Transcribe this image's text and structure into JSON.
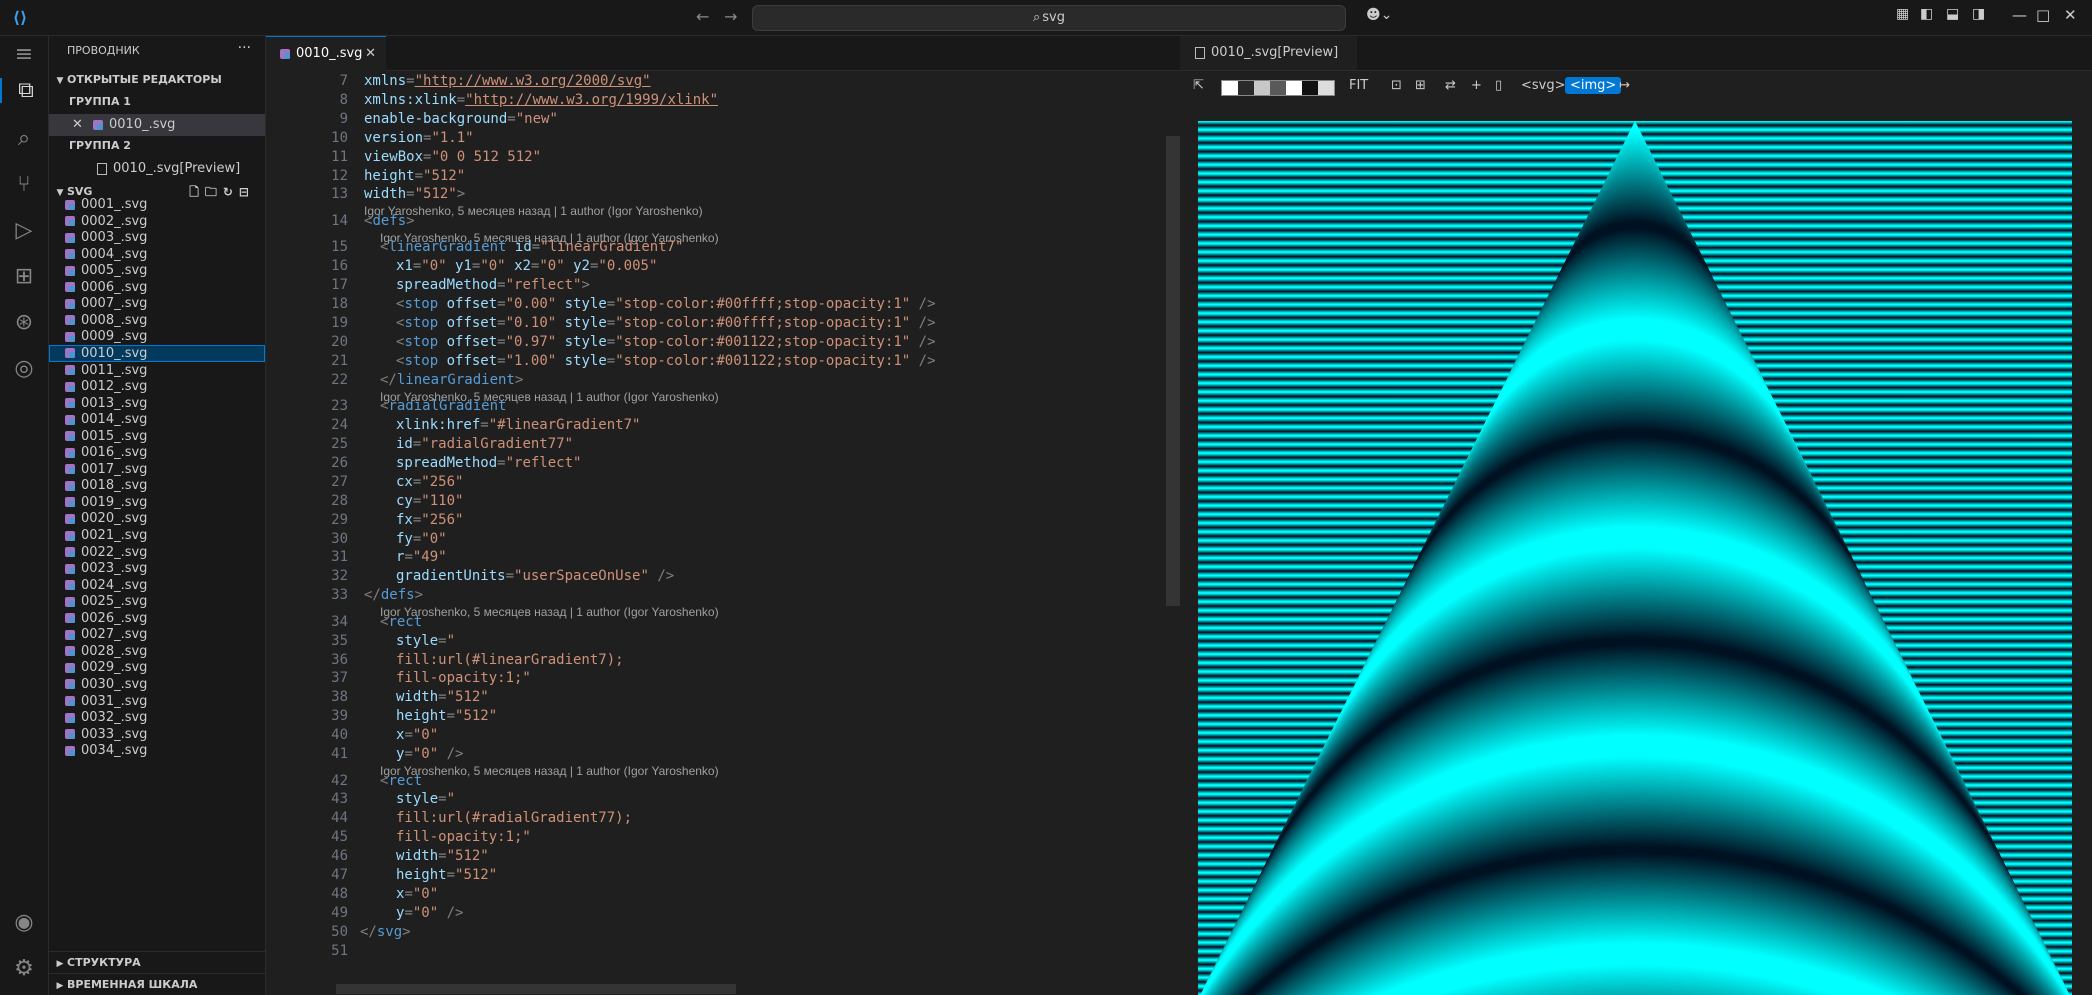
{
  "titlebar": {
    "search_text": "svg",
    "logo": "vscode-logo",
    "back": "←",
    "forward": "→"
  },
  "activity_bar": {
    "icons": [
      "menu-icon",
      "explorer-icon",
      "search-icon",
      "source-control-icon",
      "run-debug-icon",
      "extensions-icon",
      "git-graph-icon",
      "remote-explorer-icon",
      "account-icon",
      "settings-icon"
    ]
  },
  "sidebar": {
    "title": "ПРОВОДНИК",
    "open_editors_label": "ОТКРЫТЫЕ РЕДАКТОРЫ",
    "group1_label": "ГРУППА 1",
    "group1_file": "0010_.svg",
    "group2_label": "ГРУППА 2",
    "group2_file": "0010_.svg[Preview]",
    "folder_label": "SVG",
    "files": [
      "0001_.svg",
      "0002_.svg",
      "0003_.svg",
      "0004_.svg",
      "0005_.svg",
      "0006_.svg",
      "0007_.svg",
      "0008_.svg",
      "0009_.svg",
      "0010_.svg",
      "0011_.svg",
      "0012_.svg",
      "0013_.svg",
      "0014_.svg",
      "0015_.svg",
      "0016_.svg",
      "0017_.svg",
      "0018_.svg",
      "0019_.svg",
      "0020_.svg",
      "0021_.svg",
      "0022_.svg",
      "0023_.svg",
      "0024_.svg",
      "0025_.svg",
      "0026_.svg",
      "0027_.svg",
      "0028_.svg",
      "0029_.svg",
      "0030_.svg",
      "0031_.svg",
      "0032_.svg",
      "0033_.svg",
      "0034_.svg"
    ],
    "selected_file": "0010_.svg",
    "outline_label": "СТРУКТУРА",
    "timeline_label": "ВРЕМЕННАЯ ШКАЛА"
  },
  "editor": {
    "tab_label": "0010_.svg",
    "blame_text": "Igor Yaroshenko, 5 месяцев назад | 1 author (Igor Yaroshenko)",
    "lines": [
      {
        "n": "7",
        "indent": 1,
        "parts": [
          [
            "attr",
            "xmlns"
          ],
          [
            "punc",
            "="
          ],
          [
            "ustr",
            "\"http://www.w3.org/2000/svg\""
          ]
        ]
      },
      {
        "n": "8",
        "indent": 1,
        "parts": [
          [
            "attr",
            "xmlns:xlink"
          ],
          [
            "punc",
            "="
          ],
          [
            "ustr",
            "\"http://www.w3.org/1999/xlink\""
          ]
        ]
      },
      {
        "n": "9",
        "indent": 1,
        "parts": [
          [
            "attr",
            "enable-background"
          ],
          [
            "punc",
            "="
          ],
          [
            "str",
            "\"new\""
          ]
        ]
      },
      {
        "n": "10",
        "indent": 1,
        "parts": [
          [
            "attr",
            "version"
          ],
          [
            "punc",
            "="
          ],
          [
            "str",
            "\"1.1\""
          ]
        ]
      },
      {
        "n": "11",
        "indent": 1,
        "parts": [
          [
            "attr",
            "viewBox"
          ],
          [
            "punc",
            "="
          ],
          [
            "str",
            "\"0 0 512 512\""
          ]
        ]
      },
      {
        "n": "12",
        "indent": 1,
        "parts": [
          [
            "attr",
            "height"
          ],
          [
            "punc",
            "="
          ],
          [
            "str",
            "\"512\""
          ]
        ]
      },
      {
        "n": "13",
        "indent": 1,
        "parts": [
          [
            "attr",
            "width"
          ],
          [
            "punc",
            "="
          ],
          [
            "str",
            "\"512\""
          ],
          [
            "punc",
            ">"
          ]
        ],
        "blame_after": "0"
      },
      {
        "n": "14",
        "indent": 1,
        "parts": [
          [
            "punc",
            "<"
          ],
          [
            "tag",
            "defs"
          ],
          [
            "punc",
            ">"
          ]
        ],
        "blame_after": "1"
      },
      {
        "n": "15",
        "indent": 2,
        "parts": [
          [
            "punc",
            "<"
          ],
          [
            "tag",
            "linearGradient"
          ],
          [
            "text",
            " "
          ],
          [
            "attr",
            "id"
          ],
          [
            "punc",
            "="
          ],
          [
            "str",
            "\"linearGradient7\""
          ]
        ]
      },
      {
        "n": "16",
        "indent": 3,
        "parts": [
          [
            "attr",
            "x1"
          ],
          [
            "punc",
            "="
          ],
          [
            "str",
            "\"0\""
          ],
          [
            "text",
            " "
          ],
          [
            "attr",
            "y1"
          ],
          [
            "punc",
            "="
          ],
          [
            "str",
            "\"0\""
          ],
          [
            "text",
            " "
          ],
          [
            "attr",
            "x2"
          ],
          [
            "punc",
            "="
          ],
          [
            "str",
            "\"0\""
          ],
          [
            "text",
            " "
          ],
          [
            "attr",
            "y2"
          ],
          [
            "punc",
            "="
          ],
          [
            "str",
            "\"0.005\""
          ]
        ]
      },
      {
        "n": "17",
        "indent": 3,
        "parts": [
          [
            "attr",
            "spreadMethod"
          ],
          [
            "punc",
            "="
          ],
          [
            "str",
            "\"reflect\""
          ],
          [
            "punc",
            ">"
          ]
        ]
      },
      {
        "n": "18",
        "indent": 3,
        "parts": [
          [
            "punc",
            "<"
          ],
          [
            "tag",
            "stop"
          ],
          [
            "text",
            " "
          ],
          [
            "attr",
            "offset"
          ],
          [
            "punc",
            "="
          ],
          [
            "str",
            "\"0.00\""
          ],
          [
            "text",
            " "
          ],
          [
            "attr",
            "style"
          ],
          [
            "punc",
            "="
          ],
          [
            "str",
            "\"stop-color:#00ffff;stop-opacity:1\""
          ],
          [
            "text",
            " "
          ],
          [
            "punc",
            "/>"
          ]
        ]
      },
      {
        "n": "19",
        "indent": 3,
        "parts": [
          [
            "punc",
            "<"
          ],
          [
            "tag",
            "stop"
          ],
          [
            "text",
            " "
          ],
          [
            "attr",
            "offset"
          ],
          [
            "punc",
            "="
          ],
          [
            "str",
            "\"0.10\""
          ],
          [
            "text",
            " "
          ],
          [
            "attr",
            "style"
          ],
          [
            "punc",
            "="
          ],
          [
            "str",
            "\"stop-color:#00ffff;stop-opacity:1\""
          ],
          [
            "text",
            " "
          ],
          [
            "punc",
            "/>"
          ]
        ]
      },
      {
        "n": "20",
        "indent": 3,
        "parts": [
          [
            "punc",
            "<"
          ],
          [
            "tag",
            "stop"
          ],
          [
            "text",
            " "
          ],
          [
            "attr",
            "offset"
          ],
          [
            "punc",
            "="
          ],
          [
            "str",
            "\"0.97\""
          ],
          [
            "text",
            " "
          ],
          [
            "attr",
            "style"
          ],
          [
            "punc",
            "="
          ],
          [
            "str",
            "\"stop-color:#001122;stop-opacity:1\""
          ],
          [
            "text",
            " "
          ],
          [
            "punc",
            "/>"
          ]
        ]
      },
      {
        "n": "21",
        "indent": 3,
        "parts": [
          [
            "punc",
            "<"
          ],
          [
            "tag",
            "stop"
          ],
          [
            "text",
            " "
          ],
          [
            "attr",
            "offset"
          ],
          [
            "punc",
            "="
          ],
          [
            "str",
            "\"1.00\""
          ],
          [
            "text",
            " "
          ],
          [
            "attr",
            "style"
          ],
          [
            "punc",
            "="
          ],
          [
            "str",
            "\"stop-color:#001122;stop-opacity:1\""
          ],
          [
            "text",
            " "
          ],
          [
            "punc",
            "/>"
          ]
        ]
      },
      {
        "n": "22",
        "indent": 2,
        "parts": [
          [
            "punc",
            "</"
          ],
          [
            "tag",
            "linearGradient"
          ],
          [
            "punc",
            ">"
          ]
        ],
        "blame_after": "2"
      },
      {
        "n": "23",
        "indent": 2,
        "parts": [
          [
            "punc",
            "<"
          ],
          [
            "tag",
            "radialGradient"
          ]
        ]
      },
      {
        "n": "24",
        "indent": 3,
        "parts": [
          [
            "attr",
            "xlink:href"
          ],
          [
            "punc",
            "="
          ],
          [
            "str",
            "\"#linearGradient7\""
          ]
        ]
      },
      {
        "n": "25",
        "indent": 3,
        "parts": [
          [
            "attr",
            "id"
          ],
          [
            "punc",
            "="
          ],
          [
            "str",
            "\"radialGradient77\""
          ]
        ]
      },
      {
        "n": "26",
        "indent": 3,
        "parts": [
          [
            "attr",
            "spreadMethod"
          ],
          [
            "punc",
            "="
          ],
          [
            "str",
            "\"reflect\""
          ]
        ]
      },
      {
        "n": "27",
        "indent": 3,
        "parts": [
          [
            "attr",
            "cx"
          ],
          [
            "punc",
            "="
          ],
          [
            "str",
            "\"256\""
          ]
        ]
      },
      {
        "n": "28",
        "indent": 3,
        "parts": [
          [
            "attr",
            "cy"
          ],
          [
            "punc",
            "="
          ],
          [
            "str",
            "\"110\""
          ]
        ]
      },
      {
        "n": "29",
        "indent": 3,
        "parts": [
          [
            "attr",
            "fx"
          ],
          [
            "punc",
            "="
          ],
          [
            "str",
            "\"256\""
          ]
        ]
      },
      {
        "n": "30",
        "indent": 3,
        "parts": [
          [
            "attr",
            "fy"
          ],
          [
            "punc",
            "="
          ],
          [
            "str",
            "\"0\""
          ]
        ]
      },
      {
        "n": "31",
        "indent": 3,
        "parts": [
          [
            "attr",
            "r"
          ],
          [
            "punc",
            "="
          ],
          [
            "str",
            "\"49\""
          ]
        ]
      },
      {
        "n": "32",
        "indent": 3,
        "parts": [
          [
            "attr",
            "gradientUnits"
          ],
          [
            "punc",
            "="
          ],
          [
            "str",
            "\"userSpaceOnUse\""
          ],
          [
            "text",
            " "
          ],
          [
            "punc",
            "/>"
          ]
        ]
      },
      {
        "n": "33",
        "indent": 1,
        "parts": [
          [
            "punc",
            "</"
          ],
          [
            "tag",
            "defs"
          ],
          [
            "punc",
            ">"
          ]
        ],
        "blame_after": "2"
      },
      {
        "n": "34",
        "indent": 2,
        "parts": [
          [
            "punc",
            "<"
          ],
          [
            "tag",
            "rect"
          ]
        ]
      },
      {
        "n": "35",
        "indent": 3,
        "parts": [
          [
            "attr",
            "style"
          ],
          [
            "punc",
            "="
          ],
          [
            "str",
            "\""
          ]
        ]
      },
      {
        "n": "36",
        "indent": 3,
        "parts": [
          [
            "str",
            "fill:url(#linearGradient7);"
          ]
        ]
      },
      {
        "n": "37",
        "indent": 3,
        "parts": [
          [
            "str",
            "fill-opacity:1;\""
          ]
        ]
      },
      {
        "n": "38",
        "indent": 3,
        "parts": [
          [
            "attr",
            "width"
          ],
          [
            "punc",
            "="
          ],
          [
            "str",
            "\"512\""
          ]
        ]
      },
      {
        "n": "39",
        "indent": 3,
        "parts": [
          [
            "attr",
            "height"
          ],
          [
            "punc",
            "="
          ],
          [
            "str",
            "\"512\""
          ]
        ]
      },
      {
        "n": "40",
        "indent": 3,
        "parts": [
          [
            "attr",
            "x"
          ],
          [
            "punc",
            "="
          ],
          [
            "str",
            "\"0\""
          ]
        ]
      },
      {
        "n": "41",
        "indent": 3,
        "parts": [
          [
            "attr",
            "y"
          ],
          [
            "punc",
            "="
          ],
          [
            "str",
            "\"0\""
          ],
          [
            "text",
            " "
          ],
          [
            "punc",
            "/>"
          ]
        ],
        "blame_after": "2"
      },
      {
        "n": "42",
        "indent": 2,
        "parts": [
          [
            "punc",
            "<"
          ],
          [
            "tag",
            "rect"
          ]
        ]
      },
      {
        "n": "43",
        "indent": 3,
        "parts": [
          [
            "attr",
            "style"
          ],
          [
            "punc",
            "="
          ],
          [
            "str",
            "\""
          ]
        ]
      },
      {
        "n": "44",
        "indent": 3,
        "parts": [
          [
            "str",
            "fill:url(#radialGradient77);"
          ]
        ]
      },
      {
        "n": "45",
        "indent": 3,
        "parts": [
          [
            "str",
            "fill-opacity:1;\""
          ]
        ]
      },
      {
        "n": "46",
        "indent": 3,
        "parts": [
          [
            "attr",
            "width"
          ],
          [
            "punc",
            "="
          ],
          [
            "str",
            "\"512\""
          ]
        ]
      },
      {
        "n": "47",
        "indent": 3,
        "parts": [
          [
            "attr",
            "height"
          ],
          [
            "punc",
            "="
          ],
          [
            "str",
            "\"512\""
          ]
        ]
      },
      {
        "n": "48",
        "indent": 3,
        "parts": [
          [
            "attr",
            "x"
          ],
          [
            "punc",
            "="
          ],
          [
            "str",
            "\"0\""
          ]
        ]
      },
      {
        "n": "49",
        "indent": 3,
        "parts": [
          [
            "attr",
            "y"
          ],
          [
            "punc",
            "="
          ],
          [
            "str",
            "\"0\""
          ],
          [
            "text",
            " "
          ],
          [
            "punc",
            "/>"
          ]
        ]
      },
      {
        "n": "50",
        "indent": 0,
        "parts": [
          [
            "punc",
            "</"
          ],
          [
            "tag",
            "svg"
          ],
          [
            "punc",
            ">"
          ]
        ]
      },
      {
        "n": "51",
        "indent": 0,
        "parts": []
      }
    ]
  },
  "preview": {
    "tab_label": "0010_.svg[Preview]",
    "fit_label": "FIT",
    "svg_label": "<svg>",
    "img_label": "<img>",
    "swatch_colors": [
      "#ffffff",
      "#2a2a2a",
      "#c8c8c8",
      "#5a5a5a",
      "#ffffff",
      "#111111",
      "#dddddd"
    ],
    "colors": {
      "cyan": "#00ffff",
      "dark": "#001122"
    }
  }
}
